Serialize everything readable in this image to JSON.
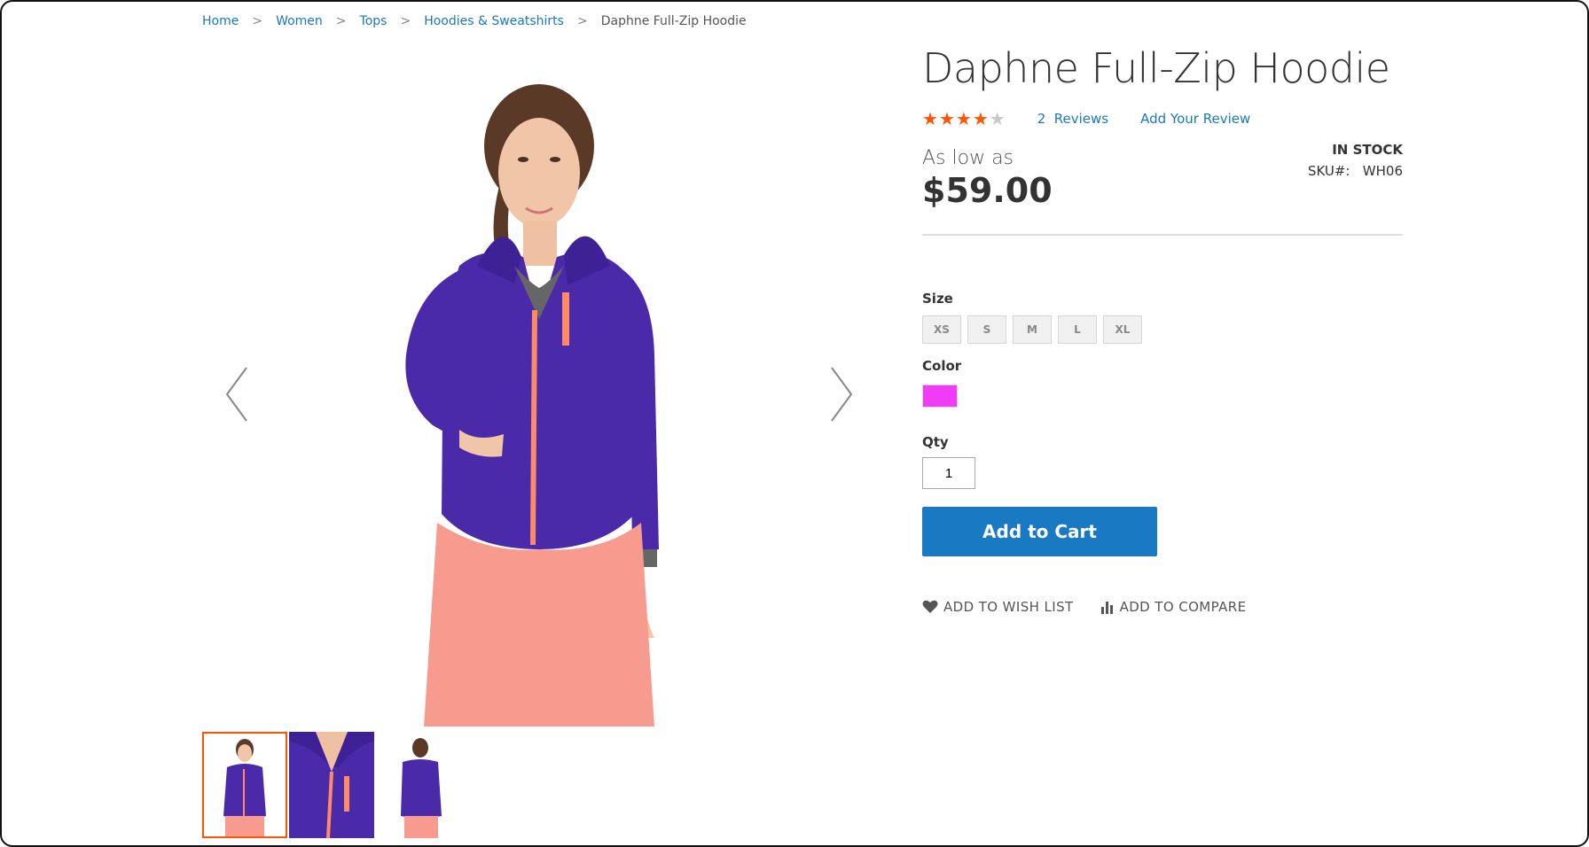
{
  "breadcrumb": {
    "items": [
      "Home",
      "Women",
      "Tops",
      "Hoodies & Sweatshirts"
    ],
    "current": "Daphne Full-Zip Hoodie",
    "separator": ">"
  },
  "product": {
    "title": "Daphne Full-Zip Hoodie",
    "rating": 4,
    "rating_max": 5,
    "reviews_count": "2",
    "reviews_label": "Reviews",
    "add_review_label": "Add Your Review",
    "price_prefix": "As low as",
    "price": "$59.00",
    "stock_status": "IN STOCK",
    "sku_label": "SKU#:",
    "sku": "WH06"
  },
  "options": {
    "size_label": "Size",
    "sizes": [
      "XS",
      "S",
      "M",
      "L",
      "XL"
    ],
    "color_label": "Color",
    "colors": [
      "#f03cf7"
    ],
    "qty_label": "Qty",
    "qty_value": "1"
  },
  "actions": {
    "add_to_cart_label": "Add to Cart",
    "wishlist_label": "ADD TO WISH LIST",
    "compare_label": "ADD TO COMPARE"
  },
  "colors": {
    "link": "#1979c3",
    "star_on": "#ff5501",
    "star_off": "#c8c8c8",
    "button": "#1979c3",
    "jacket": "#4a2aa8",
    "zip": "#ff8a6a",
    "pants": "#f79b8f"
  },
  "gallery": {
    "thumbnail_count": 3,
    "active_index": 0
  }
}
